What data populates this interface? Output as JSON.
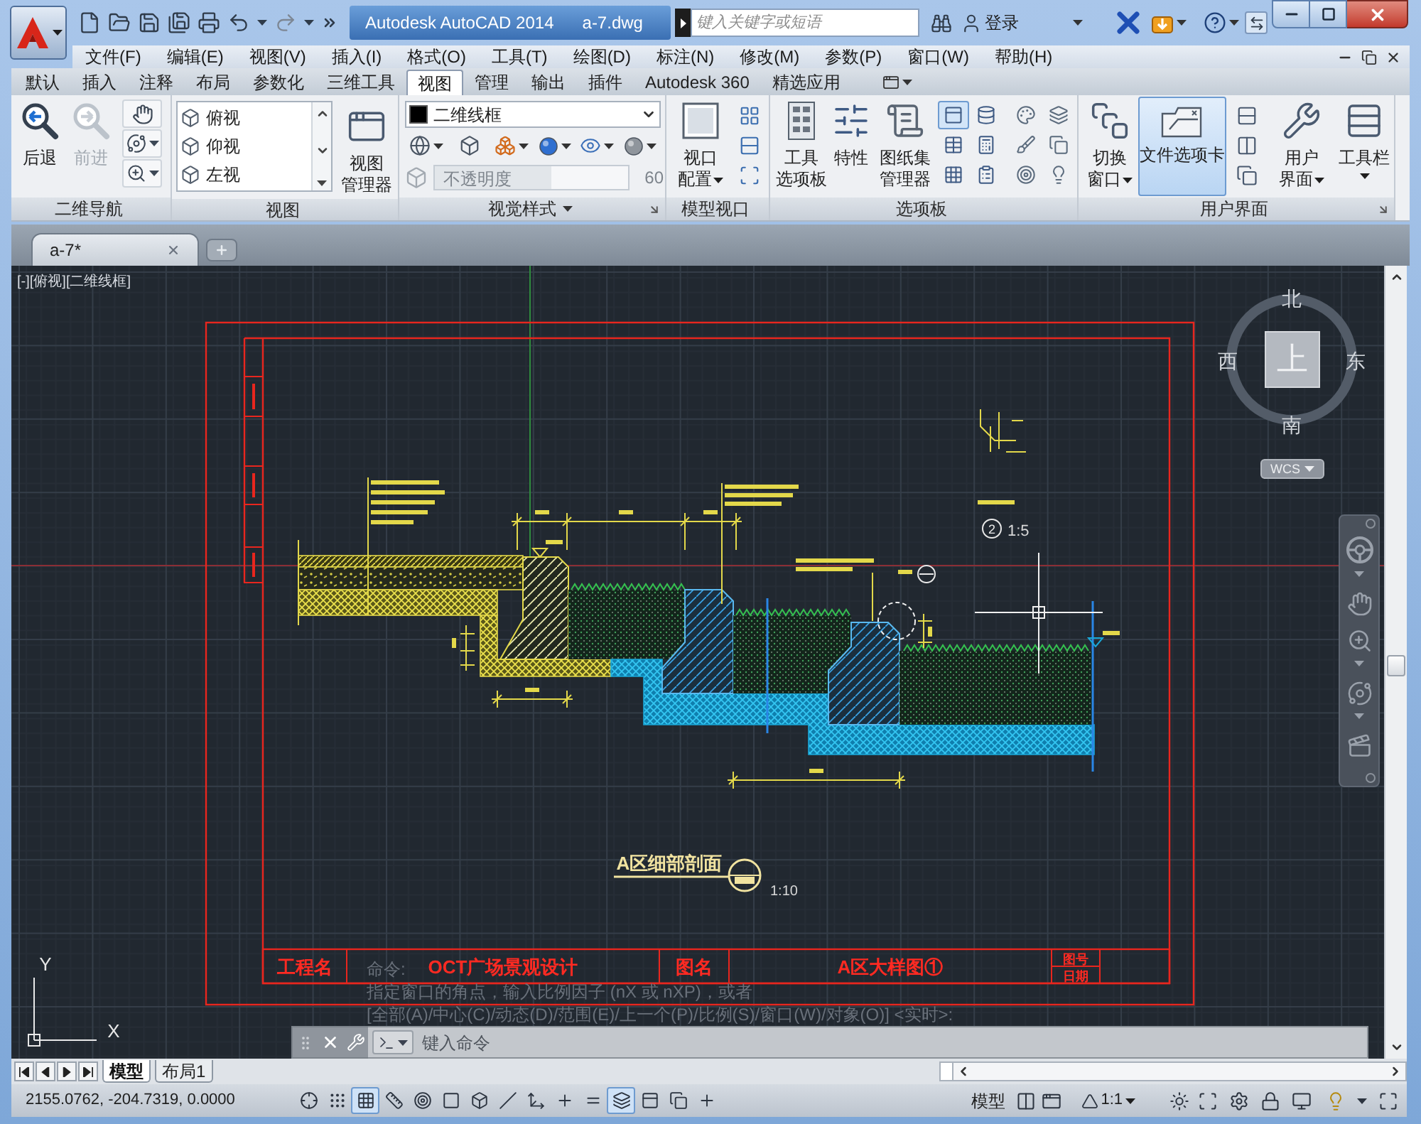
{
  "title_bar": {
    "app_title": "Autodesk AutoCAD 2014",
    "file_name": "a-7.dwg",
    "search": {
      "placeholder": "键入关键字或短语"
    },
    "sign_in": "登录"
  },
  "menu_bar": [
    "文件(F)",
    "编辑(E)",
    "视图(V)",
    "插入(I)",
    "格式(O)",
    "工具(T)",
    "绘图(D)",
    "标注(N)",
    "修改(M)",
    "参数(P)",
    "窗口(W)",
    "帮助(H)"
  ],
  "ribbon_tabs": [
    {
      "label": "默认",
      "selected": false
    },
    {
      "label": "插入",
      "selected": false
    },
    {
      "label": "注释",
      "selected": false
    },
    {
      "label": "布局",
      "selected": false
    },
    {
      "label": "参数化",
      "selected": false
    },
    {
      "label": "三维工具",
      "selected": false
    },
    {
      "label": "视图",
      "selected": true
    },
    {
      "label": "管理",
      "selected": false
    },
    {
      "label": "输出",
      "selected": false
    },
    {
      "label": "插件",
      "selected": false
    },
    {
      "label": "Autodesk 360",
      "selected": false
    },
    {
      "label": "精选应用",
      "selected": false
    }
  ],
  "ribbon": {
    "navigation": {
      "title": "二维导航",
      "back": {
        "label": "后退",
        "disabled": false
      },
      "forward": {
        "label": "前进",
        "disabled": true
      }
    },
    "views": {
      "title": "视图",
      "items": [
        "俯视",
        "仰视",
        "左视"
      ],
      "manager": [
        "视图",
        "管理器"
      ]
    },
    "visual_styles": {
      "title": "视觉样式",
      "style": "二维线框",
      "opacity": {
        "label": "不透明度",
        "value": "60",
        "level": 0.6,
        "disabled": true
      }
    },
    "model_viewports": {
      "title": "模型视口",
      "configuration": [
        "视口",
        "配置"
      ]
    },
    "palettes": {
      "title": "选项板",
      "tool_palettes": [
        "工具",
        "选项板"
      ],
      "properties": [
        "特性"
      ],
      "sheet_set_manager": [
        "图纸集",
        "管理器"
      ],
      "toggles": [
        {
          "selected": true
        },
        {
          "selected": false
        },
        {
          "selected": false
        },
        {
          "selected": false
        },
        {
          "selected": false
        },
        {
          "selected": false
        }
      ]
    },
    "user_interface": {
      "title": "用户界面",
      "switch_windows": [
        "切换",
        "窗口"
      ],
      "file_tabs": {
        "label": "文件选项卡",
        "selected": true
      },
      "user_interface": [
        "用户",
        "界面"
      ],
      "toolbars": [
        "工具栏"
      ]
    }
  },
  "file_tabs": [
    {
      "label": "a-7*",
      "selected": true
    }
  ],
  "viewport": {
    "controls": "[-][俯视][二维线框]"
  },
  "viewcube": {
    "top": "上",
    "north": "北",
    "west": "西",
    "east": "东",
    "south": "南",
    "ucs": "WCS"
  },
  "drawing": {
    "title_block": [
      "工程名",
      "OCT广场景观设计",
      "图名",
      "A区大样图①"
    ],
    "title_block_small": [
      "图号",
      "日期"
    ],
    "section_title": "A区细部剖面",
    "section_scale": "1:10",
    "detail_number": "2",
    "detail_scale": "1:5",
    "ucs_axes": {
      "x": "X",
      "y": "Y"
    }
  },
  "command_line": {
    "history": [
      "命令:",
      "指定窗口的角点，输入比例因子 (nX 或 nXP)，或者",
      "[全部(A)/中心(C)/动态(D)/范围(E)/上一个(P)/比例(S)/窗口(W)/对象(O)] <实时>:"
    ],
    "placeholder": "键入命令"
  },
  "layout_tabs": [
    {
      "label": "模型",
      "selected": true
    },
    {
      "label": "布局1",
      "selected": false
    }
  ],
  "status_bar": {
    "coordinates": "2155.0762, -204.7319, 0.0000",
    "toggles": [
      {
        "selected": false
      },
      {
        "selected": false
      },
      {
        "selected": true
      },
      {
        "selected": false
      },
      {
        "selected": false
      },
      {
        "selected": false
      },
      {
        "selected": false
      },
      {
        "selected": false
      },
      {
        "selected": false
      },
      {
        "selected": false
      },
      {
        "selected": false
      },
      {
        "selected": true
      },
      {
        "selected": false
      },
      {
        "selected": false
      },
      {
        "selected": false
      }
    ],
    "model": "模型",
    "annotation_scale": "1:1"
  }
}
